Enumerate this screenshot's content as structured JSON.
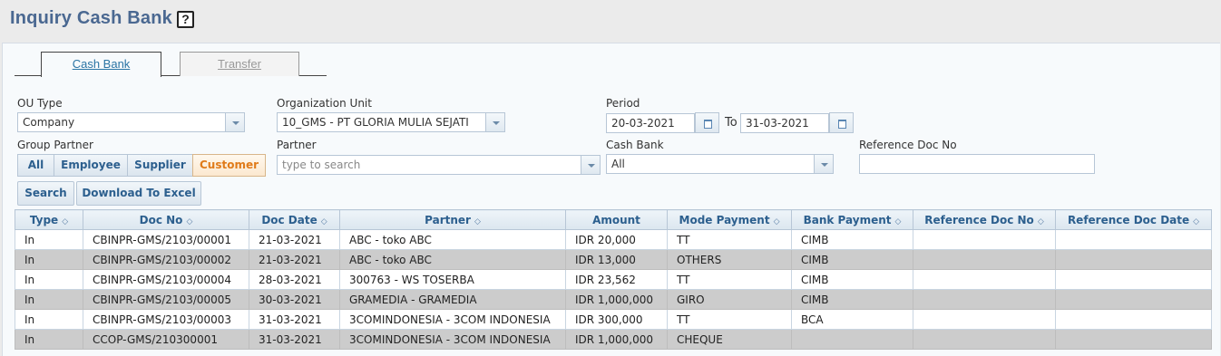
{
  "page": {
    "title": "Inquiry Cash Bank",
    "help_glyph": "?"
  },
  "tabs": [
    {
      "label": "Cash Bank",
      "active": true
    },
    {
      "label": "Transfer",
      "active": false
    }
  ],
  "filters": {
    "ou_type": {
      "label": "OU Type",
      "value": "Company"
    },
    "organization_unit": {
      "label": "Organization Unit",
      "value": "10_GMS - PT GLORIA MULIA SEJATI"
    },
    "period": {
      "label": "Period",
      "from": "20-03-2021",
      "to_label": "To",
      "to": "31-03-2021"
    },
    "group_partner": {
      "label": "Group Partner",
      "options": [
        "All",
        "Employee",
        "Supplier",
        "Customer"
      ],
      "selected": "Customer"
    },
    "partner": {
      "label": "Partner",
      "value": "",
      "placeholder": "type to search"
    },
    "cash_bank": {
      "label": "Cash Bank",
      "value": "All"
    },
    "reference_doc_no": {
      "label": "Reference Doc No",
      "value": ""
    }
  },
  "actions": {
    "search": "Search",
    "download": "Download To Excel"
  },
  "table": {
    "columns": [
      "Type",
      "Doc No",
      "Doc Date",
      "Partner",
      "Amount",
      "Mode Payment",
      "Bank Payment",
      "Reference Doc No",
      "Reference Doc Date"
    ],
    "sortable": [
      true,
      true,
      true,
      true,
      false,
      true,
      true,
      true,
      true
    ],
    "sort_glyph": "◇",
    "rows": [
      [
        "In",
        "CBINPR-GMS/2103/00001",
        "21-03-2021",
        "ABC - toko ABC",
        "IDR 20,000",
        "TT",
        "CIMB",
        "",
        ""
      ],
      [
        "In",
        "CBINPR-GMS/2103/00002",
        "21-03-2021",
        "ABC - toko ABC",
        "IDR 13,000",
        "OTHERS",
        "CIMB",
        "",
        ""
      ],
      [
        "In",
        "CBINPR-GMS/2103/00004",
        "28-03-2021",
        "300763 - WS TOSERBA",
        "IDR 23,562",
        "TT",
        "CIMB",
        "",
        ""
      ],
      [
        "In",
        "CBINPR-GMS/2103/00005",
        "30-03-2021",
        "GRAMEDIA - GRAMEDIA",
        "IDR 1,000,000",
        "GIRO",
        "CIMB",
        "",
        ""
      ],
      [
        "In",
        "CBINPR-GMS/2103/00003",
        "31-03-2021",
        "3COMINDONESIA - 3COM INDONESIA",
        "IDR 300,000",
        "TT",
        "BCA",
        "",
        ""
      ],
      [
        "In",
        "CCOP-GMS/210300001",
        "31-03-2021",
        "3COMINDONESIA - 3COM INDONESIA",
        "IDR 1,000,000",
        "CHEQUE",
        "",
        "",
        ""
      ]
    ]
  },
  "colors": {
    "title": "#4a6891",
    "header_text": "#2c5f8e",
    "active_group": "#e07b1a",
    "alt_row": "#cccccc"
  }
}
